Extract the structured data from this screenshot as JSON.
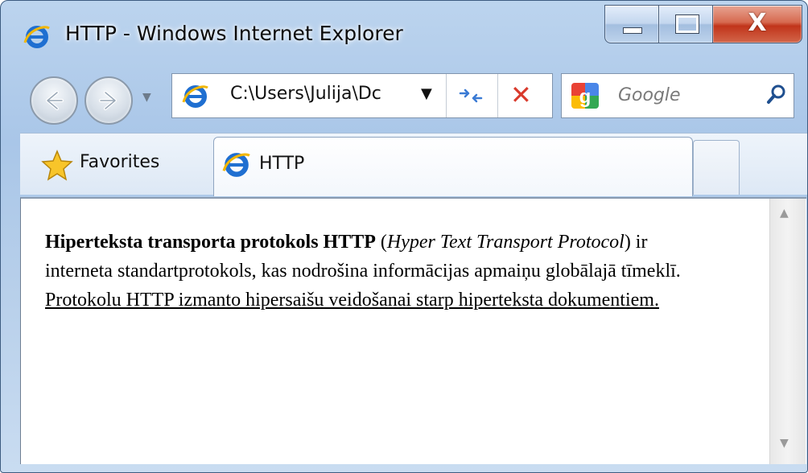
{
  "window": {
    "title": "HTTP - Windows Internet Explorer",
    "close_glyph": "X"
  },
  "nav": {
    "address": "C:\\Users\\Julija\\Dc",
    "search_placeholder": "Google"
  },
  "favorites": {
    "label": "Favorites",
    "tab_label": "HTTP"
  },
  "page": {
    "bold_term": "Hiperteksta transporta protokols HTTP",
    "open_paren": " (",
    "italic_term": "Hyper Text Transport Protocol",
    "body_text": ") ir interneta standartprotokols, kas nodrošina informācijas apmaiņu globālajā tīmeklī. ",
    "link_text": "Protokolu HTTP izmanto hipersaišu veidošanai starp hiperteksta dokumentiem."
  },
  "colors": {
    "close_button": "#c1341a",
    "stop_icon": "#d93a2c",
    "ie_blue": "#1f6fd1"
  },
  "icons": [
    "ie-logo-icon",
    "back-icon",
    "forward-icon",
    "dropdown-icon",
    "refresh-icon",
    "stop-icon",
    "google-icon",
    "search-icon",
    "star-icon",
    "minimize-icon",
    "maximize-icon",
    "close-icon",
    "scroll-up-icon",
    "scroll-down-icon"
  ]
}
